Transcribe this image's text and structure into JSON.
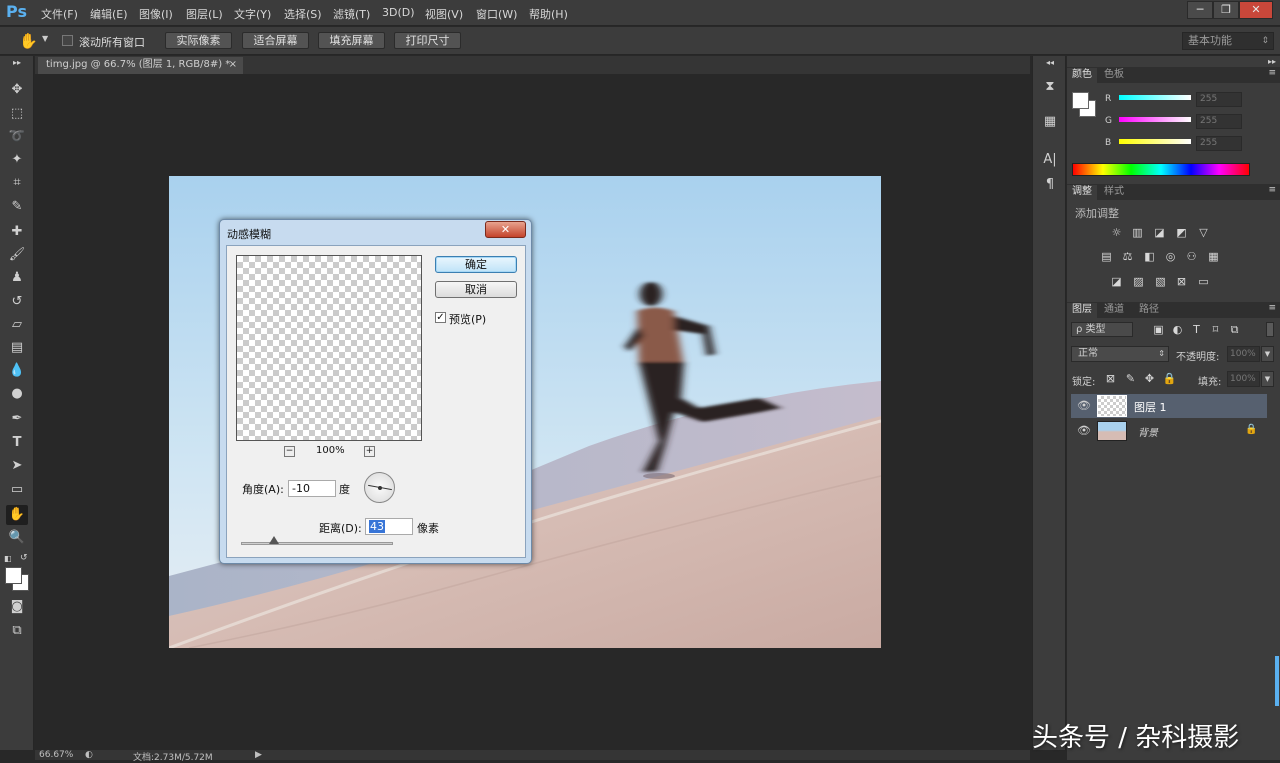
{
  "app": {
    "logo": "Ps"
  },
  "menu": [
    "文件(F)",
    "编辑(E)",
    "图像(I)",
    "图层(L)",
    "文字(Y)",
    "选择(S)",
    "滤镜(T)",
    "3D(D)",
    "视图(V)",
    "窗口(W)",
    "帮助(H)"
  ],
  "window_controls": {
    "minimize": "─",
    "restore": "❐",
    "close": "✕"
  },
  "options": {
    "checkbox_label": "滚动所有窗口",
    "buttons": [
      "实际像素",
      "适合屏幕",
      "填充屏幕",
      "打印尺寸"
    ],
    "workspace": "基本功能"
  },
  "document": {
    "tab_title": "timg.jpg @ 66.7% (图层 1, RGB/8#) *",
    "zoom_status": "66.67%",
    "doc_info": "文档:2.73M/5.72M"
  },
  "dialog": {
    "title": "动感模糊",
    "ok": "确定",
    "cancel": "取消",
    "preview_label": "预览(P)",
    "preview_checked": true,
    "zoom": "100%",
    "angle_label": "角度(A):",
    "angle_value": "-10",
    "angle_unit": "度",
    "distance_label": "距离(D):",
    "distance_value": "43",
    "distance_unit": "像素",
    "distance_fraction": 0.22
  },
  "color_panel": {
    "tabs": [
      "颜色",
      "色板"
    ],
    "channels": [
      {
        "label": "R",
        "value": "255",
        "color": "#00e5e5"
      },
      {
        "label": "G",
        "value": "255",
        "color": "#e64ae6"
      },
      {
        "label": "B",
        "value": "255",
        "color": "#e6e600"
      }
    ]
  },
  "adjust_panel": {
    "tabs": [
      "调整",
      "样式"
    ],
    "heading": "添加调整"
  },
  "layers_panel": {
    "tabs": [
      "图层",
      "通道",
      "路径"
    ],
    "filter": "ρ 类型",
    "blend_mode": "正常",
    "opacity_label": "不透明度:",
    "opacity": "100%",
    "lock_label": "锁定:",
    "fill_label": "填充:",
    "fill": "100%",
    "layers": [
      {
        "name": "图层 1",
        "selected": true
      },
      {
        "name": "背景",
        "selected": false
      }
    ]
  },
  "watermark": "头条号 / 杂科摄影"
}
